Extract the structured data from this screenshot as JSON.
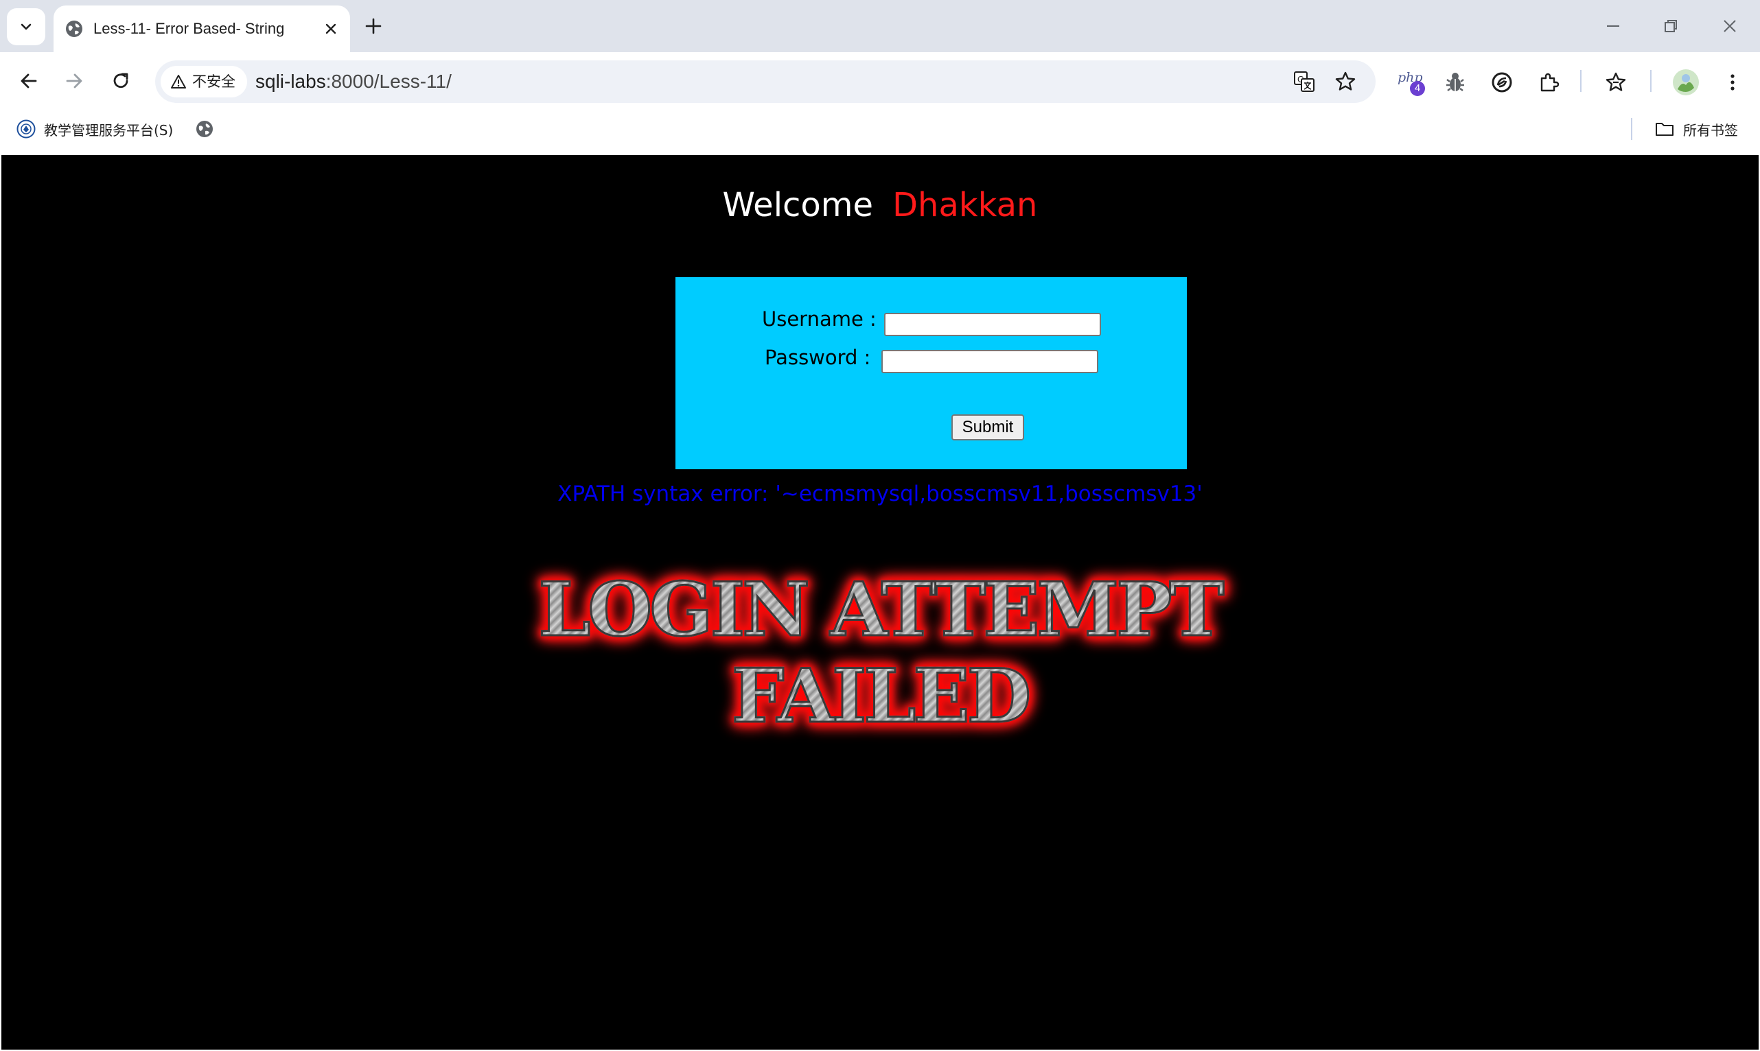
{
  "tab": {
    "title": "Less-11- Error Based- String",
    "close_label": "close"
  },
  "addressbar": {
    "security_label": "不安全",
    "host": "sqli-labs",
    "path": ":8000/Less-11/"
  },
  "bookmarks": {
    "items": [
      {
        "label": "教学管理服务平台(S)"
      }
    ],
    "all_bookmarks": "所有书签"
  },
  "extensions": {
    "badge_count": "4"
  },
  "page": {
    "welcome": "Welcome",
    "user": "Dhakkan",
    "form": {
      "username_label": "Username :",
      "password_label": "Password :",
      "username_value": "",
      "password_value": "",
      "submit_label": "Submit"
    },
    "error_message": "XPATH syntax error: '~ecmsmysql,bosscmsv11,bosscmsv13'",
    "banner_line1": "LOGIN ATTEMPT",
    "banner_line2": "FAILED"
  },
  "colors": {
    "page_bg": "#000000",
    "form_bg": "#00ccff",
    "user_color": "#ff1a1a",
    "error_color": "#0000ee"
  }
}
